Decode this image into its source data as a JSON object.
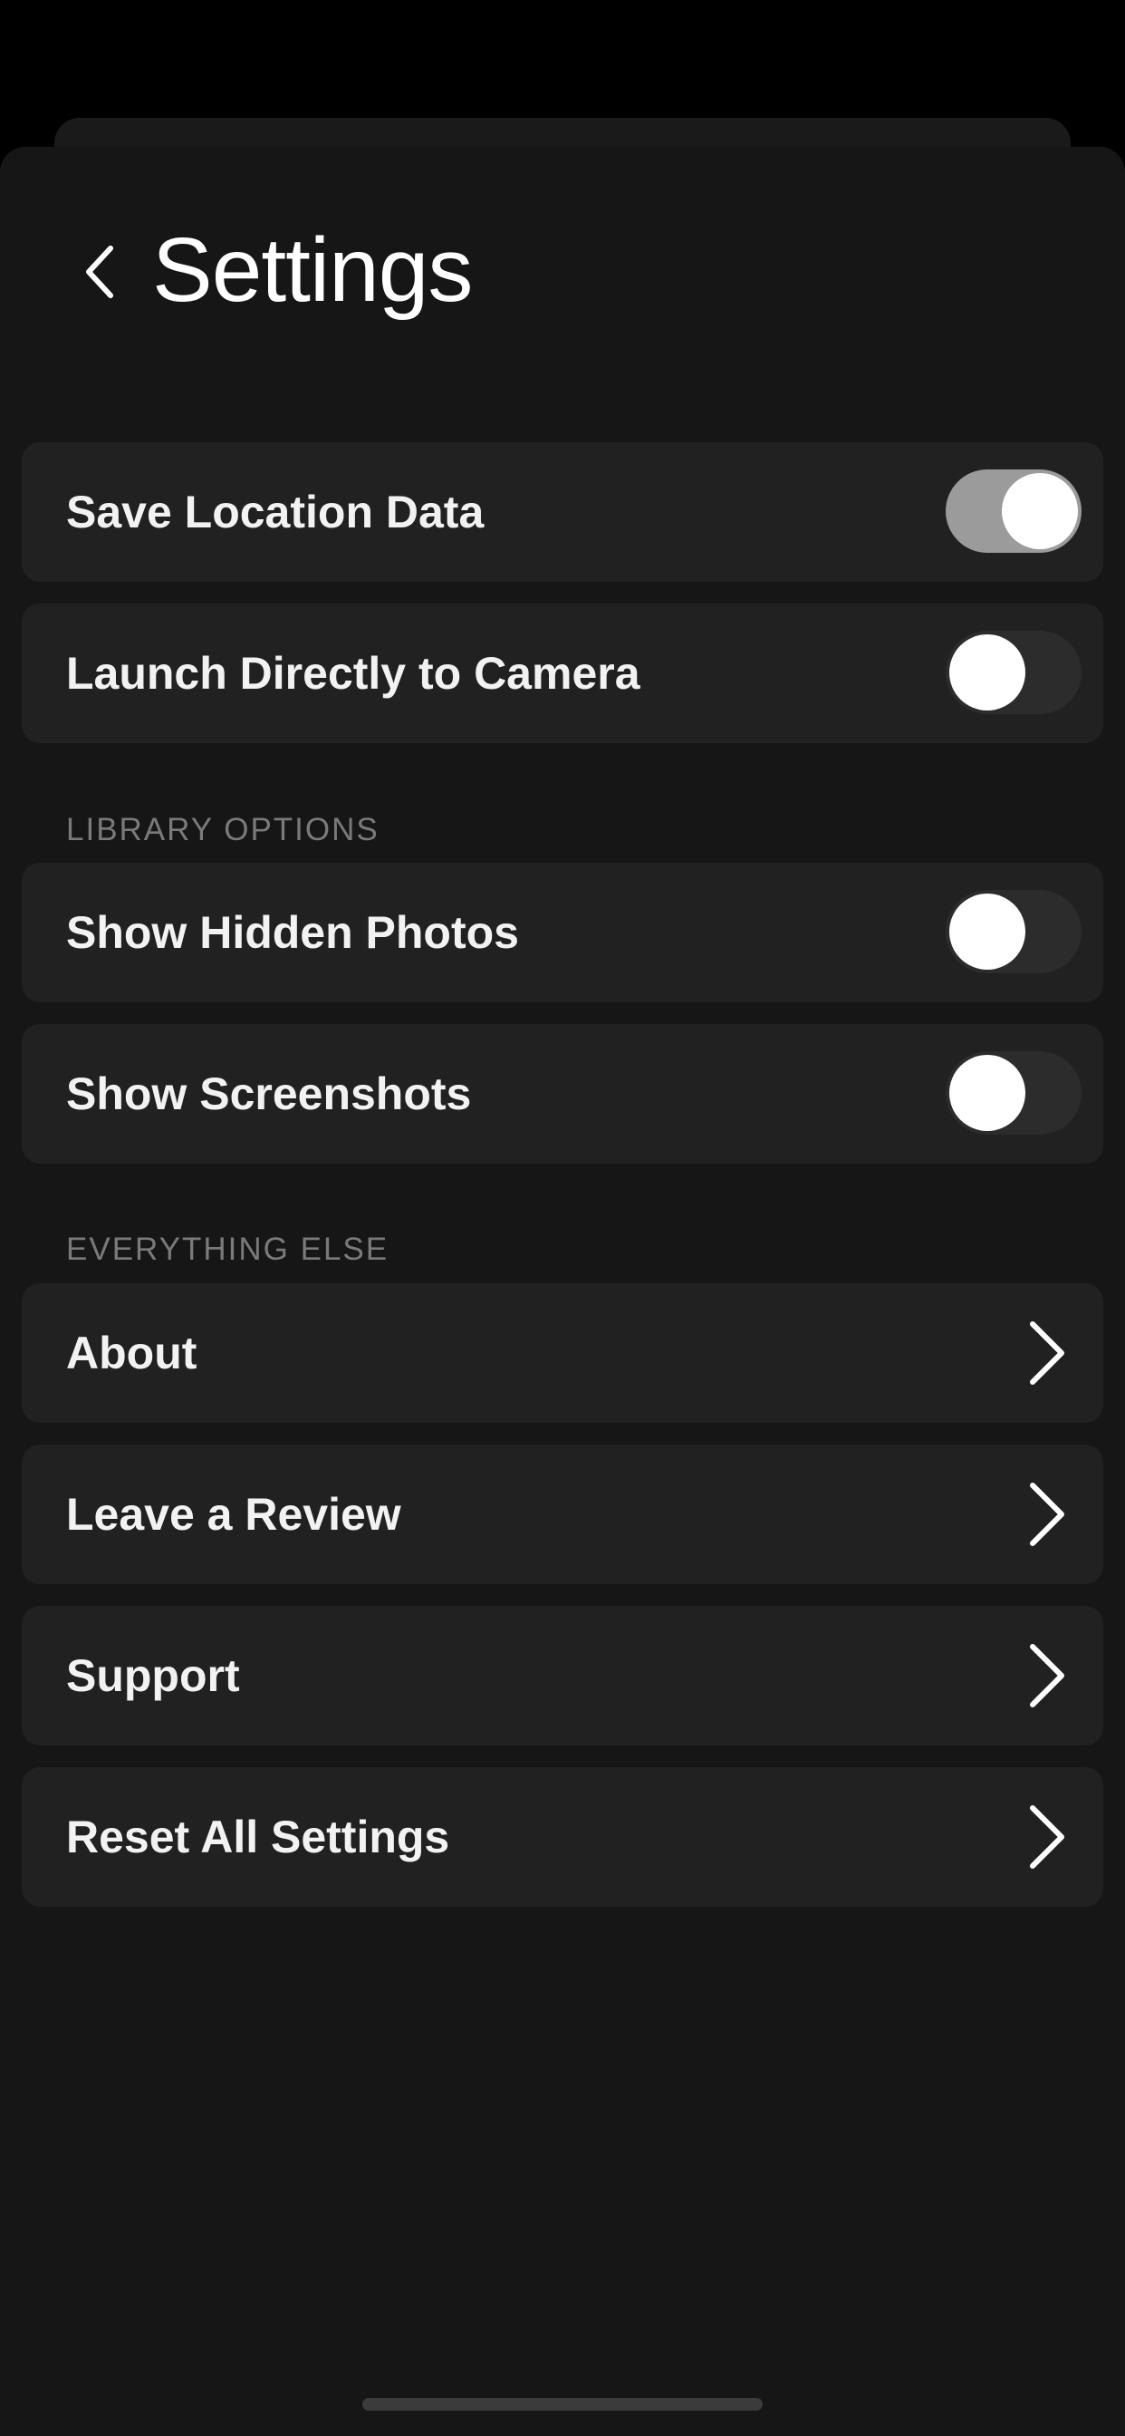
{
  "header": {
    "title": "Settings",
    "back_icon": "chevron-left-icon"
  },
  "toggles": [
    {
      "label": "Save Location Data",
      "on": true
    },
    {
      "label": "Launch Directly to Camera",
      "on": false
    }
  ],
  "library_options": {
    "title": "LIBRARY OPTIONS",
    "items": [
      {
        "label": "Show Hidden Photos",
        "on": false
      },
      {
        "label": "Show Screenshots",
        "on": false
      }
    ]
  },
  "everything_else": {
    "title": "EVERYTHING ELSE",
    "items": [
      {
        "label": "About",
        "icon": "chevron-right-icon"
      },
      {
        "label": "Leave a Review",
        "icon": "chevron-right-icon"
      },
      {
        "label": "Support",
        "icon": "chevron-right-icon"
      },
      {
        "label": "Reset All Settings",
        "icon": "chevron-right-icon"
      }
    ]
  },
  "colors": {
    "background": "#161616",
    "row": "#212121",
    "toggle_on": "#9b9b9b",
    "toggle_off": "#2c2c2c",
    "section_header": "#7a7a7a"
  }
}
